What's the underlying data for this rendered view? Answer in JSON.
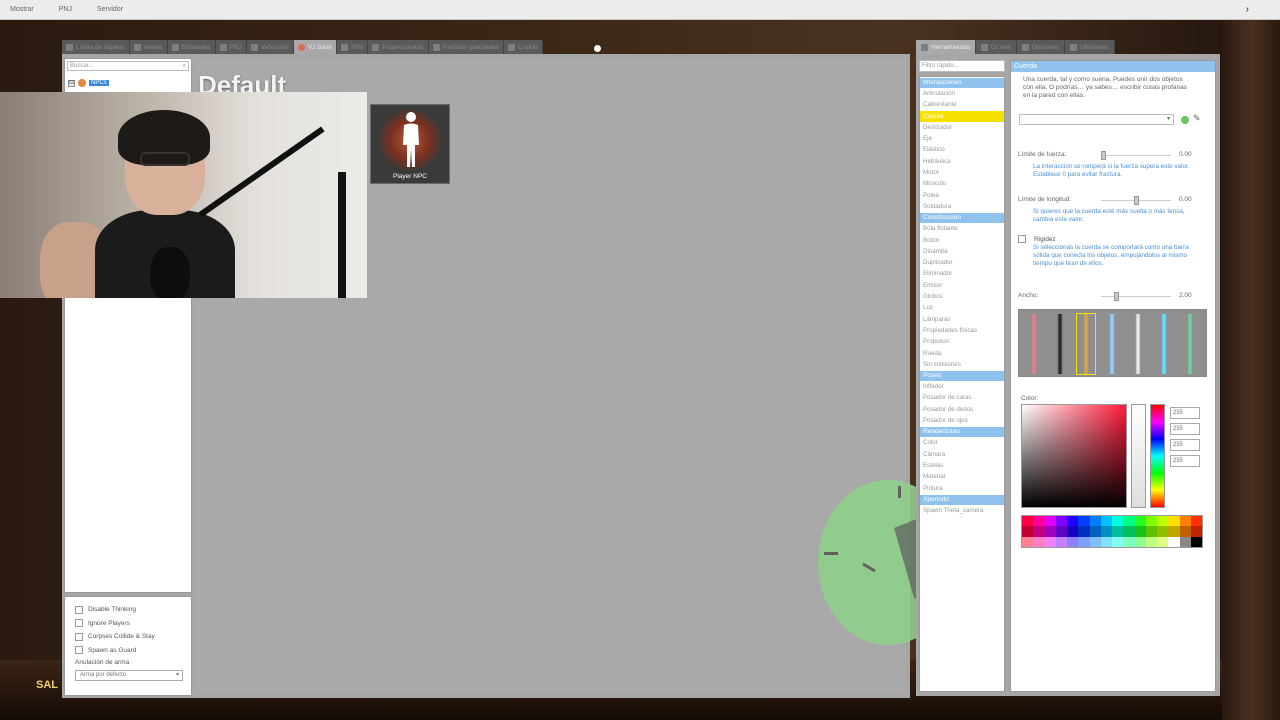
{
  "menubar": {
    "items": [
      "Mostrar",
      "PNJ",
      "Servidor"
    ]
  },
  "spawn_tabs": [
    {
      "label": "Listas de objetos",
      "icon": "list-icon",
      "active": false
    },
    {
      "label": "Armas",
      "icon": "gun-icon",
      "active": false
    },
    {
      "label": "Entidades",
      "icon": "entity-icon",
      "active": false
    },
    {
      "label": "PNJ",
      "icon": "npc-icon",
      "active": false
    },
    {
      "label": "Vehículos",
      "icon": "car-icon",
      "active": false
    },
    {
      "label": "VJ Base",
      "icon": "vj-base-icon",
      "active": true
    },
    {
      "label": "Pills",
      "icon": "pill-icon",
      "active": false
    },
    {
      "label": "Posprocesado",
      "icon": "postprocess-icon",
      "active": false
    },
    {
      "label": "Partidas guardadas",
      "icon": "save-icon",
      "active": false
    },
    {
      "label": "Copias",
      "icon": "copy-icon",
      "active": false
    }
  ],
  "tree": {
    "search_placeholder": "Buscar...",
    "node_label": "NPCs",
    "expander": "⊟"
  },
  "options": {
    "checkboxes": [
      "Disable Thinking",
      "Ignore Players",
      "Corpses Collide & Stay",
      "Spawn as Guard"
    ],
    "weapon_override_label": "Anulación de arma",
    "weapon_override_value": "Arma por defecto"
  },
  "content": {
    "title": "Default",
    "spawn_item_label": "Player NPC"
  },
  "context_tabs": [
    {
      "label": "Herramientas",
      "active": true
    },
    {
      "label": "Dr.Vrej",
      "active": false
    },
    {
      "label": "Opciones",
      "active": false
    },
    {
      "label": "Utilidades",
      "active": false
    }
  ],
  "tool_search_placeholder": "Filtro rápido...",
  "tool_categories": [
    {
      "name": "Interacciones",
      "items": [
        "Articulación",
        "Cabrestante",
        "Cuerda",
        "Deslizador",
        "Eje",
        "Elástico",
        "Hidráulica",
        "Motor",
        "Músculo",
        "Polea",
        "Soldadura"
      ]
    },
    {
      "name": "Construcción",
      "items": [
        "Bola flotante",
        "Botón",
        "Dinamita",
        "Duplicador",
        "Eliminador",
        "Emisor",
        "Globos",
        "Luz",
        "Lámparas",
        "Propiedades físicas",
        "Propulsor",
        "Rueda",
        "Sin colisiones"
      ]
    },
    {
      "name": "Poses",
      "items": [
        "Inflador",
        "Posador de caras",
        "Posador de dedos",
        "Posador de ojos"
      ]
    },
    {
      "name": "Renderizado",
      "items": [
        "Color",
        "Cámara",
        "Estelas",
        "Material",
        "Pintura"
      ]
    },
    {
      "name": "Xperiodo",
      "items": [
        "Spawn Theta_camera"
      ]
    }
  ],
  "selected_tool": "Cuerda",
  "tool_panel": {
    "title": "Cuerda",
    "description": "Una cuerda, tal y como suena. Puedes unir dos objetos con ella. O podrías… ya sabes… escribir cosas profanas en la pared con ellas.",
    "force_limit_label": "Límite de fuerza:",
    "force_limit_value": "0.00",
    "force_limit_level": 0,
    "force_hint": "La interacción se romperá si la fuerza supera este valor. Establece 0 para evitar fractura.",
    "length_limit_label": "Límite de longitud:",
    "length_limit_value": "0.00",
    "length_limit_level": 0.5,
    "length_hint": "Si quieres que la cuerda esté más suelta o más tensa, cambia este valor.",
    "rigid_label": "Rigidez",
    "rigid_hint": "Si seleccionas la cuerda se comportará como una barra sólida que conecta los objetos, empujándolos al mismo tiempo que tiran de ellos.",
    "width_label": "Ancho:",
    "width_value": "2.00",
    "width_level": 0.2,
    "color_label": "Color:",
    "rgba": [
      "255",
      "255",
      "255",
      "255"
    ]
  },
  "materials": [
    "#e67e8a",
    "#2a2a2a",
    "#d4a84a",
    "#8fd0ff",
    "#e8e8e8",
    "#5fe0ff",
    "#6fd0a0"
  ],
  "palette": [
    "#ff0040",
    "#ff00a0",
    "#e000ff",
    "#8000ff",
    "#2000ff",
    "#0040ff",
    "#0080ff",
    "#00c0ff",
    "#00ffe0",
    "#00ff80",
    "#20ff20",
    "#80ff00",
    "#c0ff00",
    "#ffe000",
    "#ff8000",
    "#ff3000",
    "#c00030",
    "#c00080",
    "#a000c0",
    "#6000c0",
    "#1800c0",
    "#0030c0",
    "#0060c0",
    "#0090c0",
    "#00c0a0",
    "#00c060",
    "#18c018",
    "#60c000",
    "#90c000",
    "#c0a800",
    "#c06000",
    "#c02400",
    "#ff8090",
    "#ff80c8",
    "#f080ff",
    "#c080ff",
    "#9080ff",
    "#80a0ff",
    "#80c0ff",
    "#80e0ff",
    "#80fff0",
    "#80ffc0",
    "#90ff90",
    "#c0ff80",
    "#e0ff80",
    "#ffffff",
    "#888888",
    "#000000"
  ],
  "hud_text": "SAL"
}
